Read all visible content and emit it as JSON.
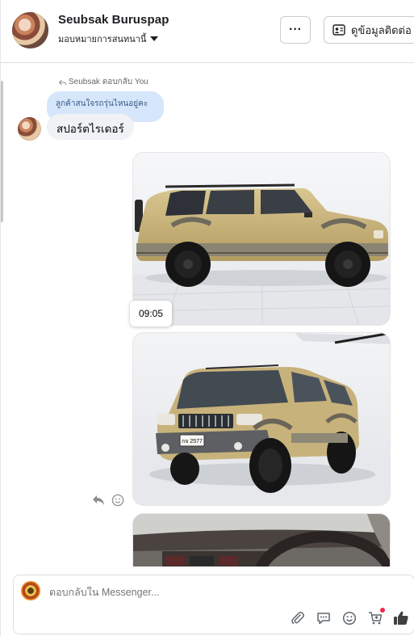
{
  "header": {
    "contact_name": "Seubsak Buruspap",
    "assign_label": "มอบหมายการสนทนานี้",
    "more_label": "···",
    "contact_info_label": "ดูข้อมูลติดต่อ"
  },
  "conversation": {
    "reply_note": "Seubsak ตอบกลับ You",
    "quoted_text": "ลูกค้าสนใจรถรุ่นไหนอยู่คะ",
    "message_text": "สปอร์ตไรเดอร์",
    "photo_timestamp": "09:05",
    "photos": [
      {
        "name": "gold-suv-side-view"
      },
      {
        "name": "gold-suv-front-view",
        "plate": "กจ 2577"
      },
      {
        "name": "suv-interior-dashboard"
      }
    ]
  },
  "composer": {
    "placeholder": "ตอบกลับใน Messenger...",
    "tools": [
      "paperclip-icon",
      "chat-bubble-icon",
      "emoji-icon",
      "cart-icon",
      "thumbs-up-icon"
    ]
  },
  "colors": {
    "quoted_bubble": "#d6e6fb",
    "message_bubble": "#f0f2f5",
    "vehicle_gold": "#c9b27a",
    "notification_dot": "#f02849"
  }
}
